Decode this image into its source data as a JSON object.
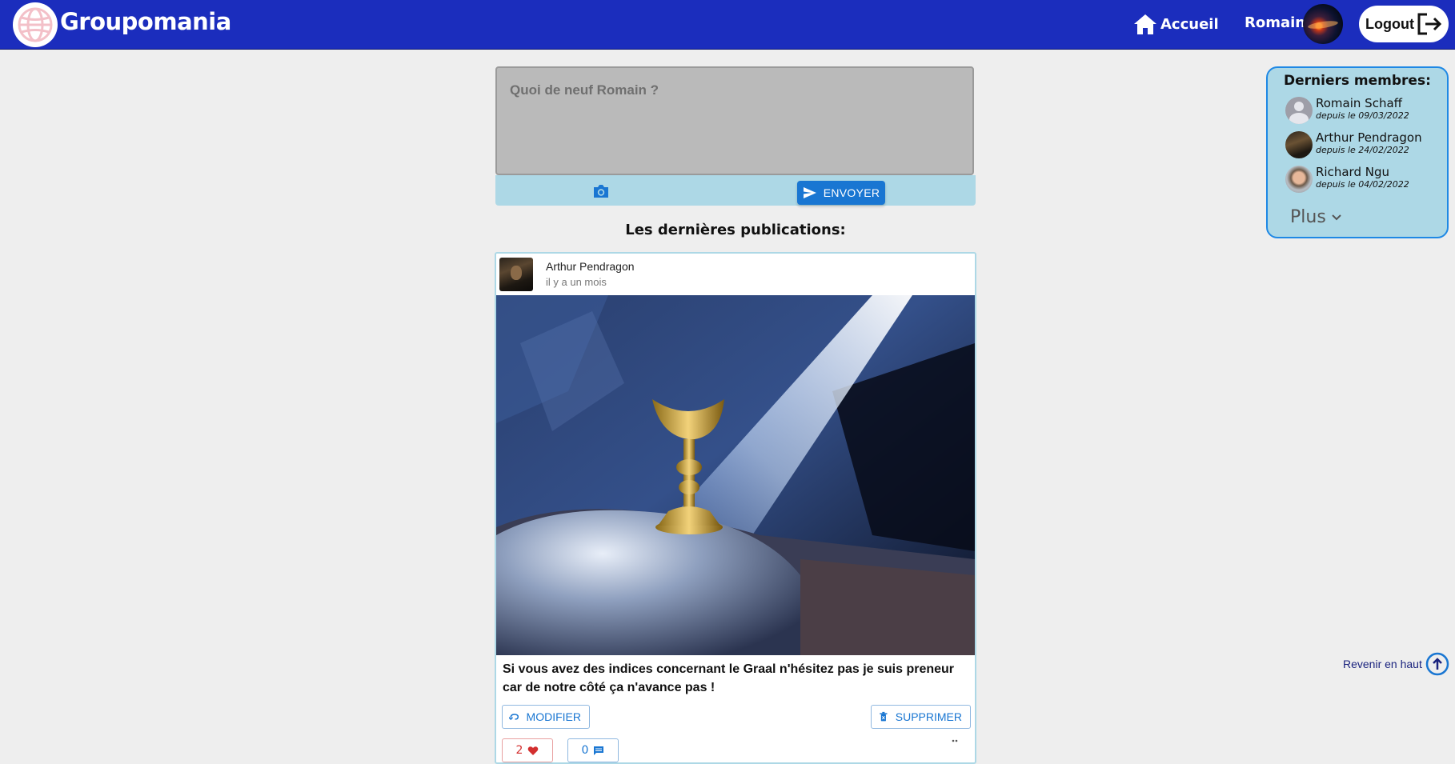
{
  "header": {
    "brand": "Groupomania",
    "home_label": "Accueil",
    "user_name": "Romain",
    "logout_label": "Logout",
    "bg_color": "#1b2dbd"
  },
  "composer": {
    "placeholder": "Quoi de neuf Romain ?",
    "send_label": "ENVOYER",
    "camera_icon": "camera-icon",
    "send_icon": "send-icon"
  },
  "feed": {
    "title": "Les dernières publications:"
  },
  "post": {
    "author": "Arthur Pendragon",
    "time": "il y a un mois",
    "text": "Si vous avez des indices concernant le Graal n'hésitez pas je suis preneur car de notre côté ça n'avance pas !",
    "edit_label": "MODIFIER",
    "delete_label": "SUPPRIMER",
    "likes": "2",
    "comments": "0"
  },
  "members": {
    "title": "Derniers membres:",
    "items": [
      {
        "name": "Romain Schaff",
        "since": "depuis le 09/03/2022"
      },
      {
        "name": "Arthur Pendragon",
        "since": "depuis le 24/02/2022"
      },
      {
        "name": "Richard Ngu",
        "since": "depuis le 04/02/2022"
      }
    ],
    "more_label": "Plus"
  },
  "back_to_top": {
    "label": "Revenir en haut"
  },
  "colors": {
    "accent": "#1976d2",
    "panel": "#add8e6",
    "like": "#d32f2f"
  }
}
